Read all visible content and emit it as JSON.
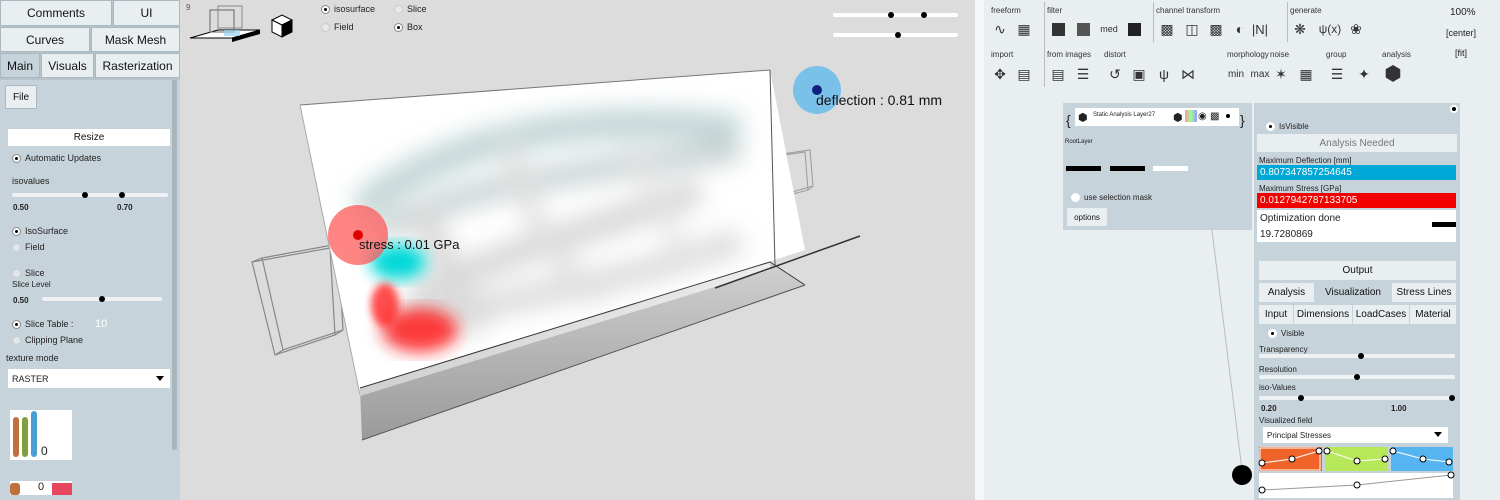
{
  "left_panel": {
    "top_tabs": [
      "Comments",
      "UI",
      "Curves",
      "Mask Mesh"
    ],
    "main_tabs": [
      "Main",
      "Visuals",
      "Rasterization"
    ],
    "file_label": "File",
    "resize_label": "Resize",
    "automatic_updates": "Automatic Updates",
    "isovalues_label": "isovalues",
    "iso_min": "0.50",
    "iso_max": "0.70",
    "isosurface_label": "IsoSurface",
    "field_label": "Field",
    "slice_label": "Slice",
    "slice_level_label": "Slice Level",
    "slice_level_value": "0.50",
    "slice_table_label": "Slice Table :",
    "slice_table_value": "10",
    "clipping_plane_label": "Clipping Plane",
    "texture_mode_label": "texture mode",
    "texture_mode_value": "RASTER",
    "histogram_value": "0",
    "histogram2_value": "0"
  },
  "viewport": {
    "corner_number": "9",
    "radio_isosurface": "isosurface",
    "radio_slice": "Slice",
    "radio_field": "Field",
    "radio_box": "Box",
    "deflection_label": "deflection : 0.81 mm",
    "stress_label": "stress : 0.01 GPa"
  },
  "toolbar": {
    "groups": [
      "freeform",
      "filter",
      "channel transform",
      "generate",
      "import",
      "from images",
      "distort",
      "morphology",
      "noise",
      "group",
      "analysis"
    ],
    "zoom": "100%",
    "center": "[center]",
    "fit": "[fit]",
    "med_label": "med",
    "min_label": "min",
    "max_label": "max",
    "n_label": "|N|",
    "psi_label": "ψ(x)"
  },
  "layer": {
    "name": "Static Analysis Layer27",
    "brace_open": "{",
    "brace_close": "}",
    "root_layer": "RootLayer",
    "use_selection_mask": "use selection mask",
    "options": "options"
  },
  "analysis": {
    "is_visible": "IsVisible",
    "analysis_needed": "Analysis Needed",
    "max_deflection_label": "Maximum Deflection [mm]",
    "max_deflection_value": "0.807347857254645",
    "max_stress_label": "Maximum Stress [GPa]",
    "max_stress_value": "0.0127942787133705",
    "optimization_done": "Optimization done",
    "time_value": "19.7280869",
    "output_label": "Output",
    "tabs1": [
      "Analysis",
      "Visualization",
      "Stress Lines"
    ],
    "tabs2": [
      "Input",
      "Dimensions",
      "LoadCases",
      "Material"
    ],
    "visible_label": "Visible",
    "transparency_label": "Transparency",
    "resolution_label": "Resolution",
    "iso_values_label": "iso-Values",
    "iso_min": "0.20",
    "iso_max": "1.00",
    "visualized_field_label": "Visualized field",
    "visualized_field_value": "Principal Stresses"
  },
  "colors": {
    "deflection": "#00a8d8",
    "stress": "#f20000",
    "accent_orange": "#f0642a",
    "accent_green": "#b7e85a",
    "accent_blue": "#56b4f0"
  }
}
